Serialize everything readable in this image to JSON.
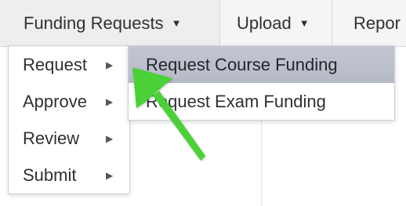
{
  "menubar": {
    "items": [
      {
        "label": "Funding Requests",
        "caret": "▼"
      },
      {
        "label": "Upload",
        "caret": "▼"
      },
      {
        "label": "Repor"
      }
    ]
  },
  "dropdown": {
    "items": [
      {
        "label": "Request",
        "arrow": "▶"
      },
      {
        "label": "Approve",
        "arrow": "▶"
      },
      {
        "label": "Review",
        "arrow": "▶"
      },
      {
        "label": "Submit",
        "arrow": "▶"
      }
    ]
  },
  "submenu": {
    "items": [
      {
        "label": "Request Course Funding",
        "highlighted": true
      },
      {
        "label": "Request Exam Funding",
        "highlighted": false
      }
    ]
  },
  "colors": {
    "highlight": "#bcc0cc",
    "pointer_arrow": "#4cd137"
  },
  "icons": {
    "pointer": "green-pointer-arrow-icon"
  }
}
